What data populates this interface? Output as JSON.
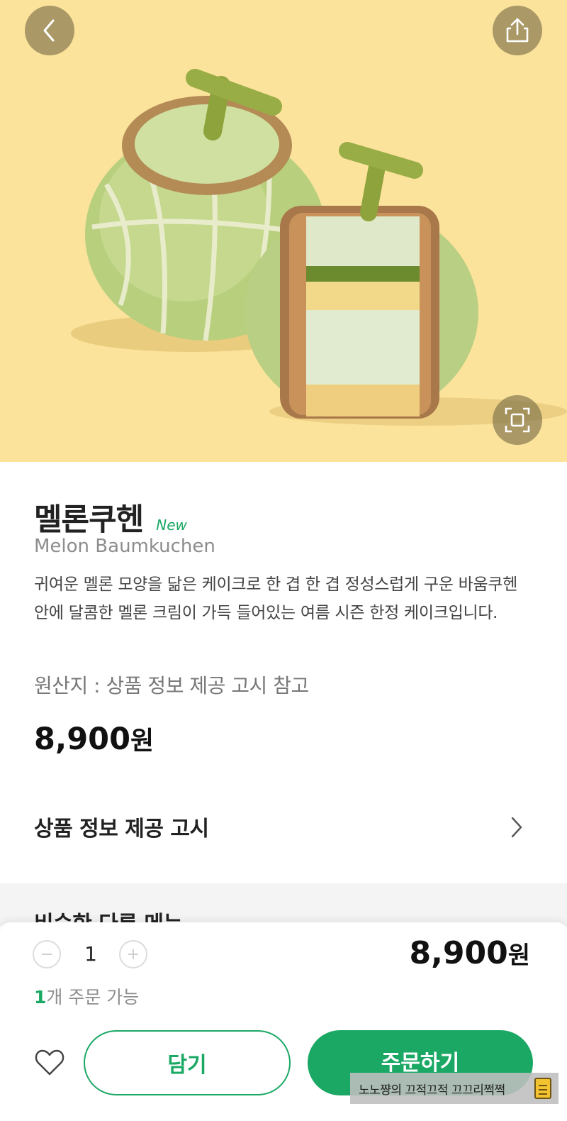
{
  "hero": {
    "background_color": "#fbe39b",
    "back_icon": "chevron-left-icon",
    "share_icon": "share-icon",
    "zoom_icon": "fullscreen-icon"
  },
  "product": {
    "name_ko": "멜론쿠헨",
    "badge": "New",
    "name_en": "Melon Baumkuchen",
    "description": "귀여운 멜론 모양을 닮은 케이크로 한 겹 한 겹 정성스럽게 구운 바움쿠헨 안에 달콤한 멜론 크림이 가득 들어있는 여름 시즌 한정 케이크입니다.",
    "origin": "원산지 : 상품 정보 제공 고시 참고",
    "price": "8,900",
    "price_unit": "원"
  },
  "notice": {
    "label": "상품 정보 제공 고시",
    "icon": "chevron-right-icon"
  },
  "similar": {
    "title": "비슷한 다른 메뉴"
  },
  "order_sheet": {
    "quantity": "1",
    "total_price": "8,900",
    "total_unit": "원",
    "available_count": "1",
    "available_text": "개 주문 가능",
    "cart_label": "담기",
    "order_label": "주문하기",
    "favorite_icon": "heart-icon"
  },
  "watermark": {
    "text": "노노쨩의 끄적끄적 끄끄리쩍쩍"
  },
  "colors": {
    "accent": "#1aa864",
    "text": "#222222",
    "muted": "#8d8d8d"
  }
}
